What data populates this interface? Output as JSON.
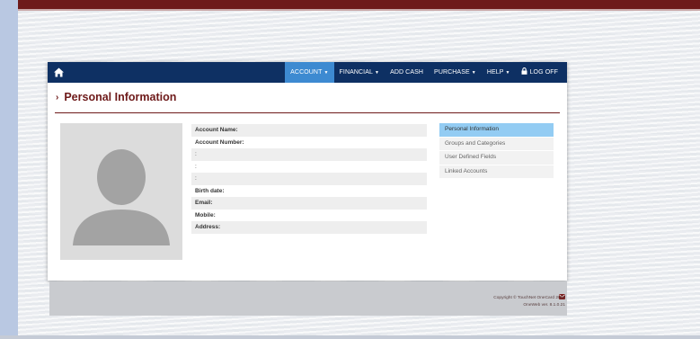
{
  "navbar": {
    "home_icon": "home-icon",
    "items": [
      {
        "label": "ACCOUNT",
        "caret": "▼"
      },
      {
        "label": "FINANCIAL",
        "caret": "▼"
      },
      {
        "label": "ADD CASH"
      },
      {
        "label": "PURCHASE",
        "caret": "▼"
      },
      {
        "label": "HELP",
        "caret": "▼"
      },
      {
        "label": "LOG OFF",
        "icon": "lock-icon"
      }
    ]
  },
  "page": {
    "title_chevron": "›",
    "title": "Personal Information"
  },
  "profile": {
    "fields": [
      {
        "label": "Account Name:"
      },
      {
        "label": "Account Number:"
      },
      {
        "label": ":"
      },
      {
        "label": ":"
      },
      {
        "label": ":"
      },
      {
        "label": "Birth date:"
      },
      {
        "label": "Email:"
      },
      {
        "label": "Mobile:"
      },
      {
        "label": "Address:"
      }
    ]
  },
  "side_menu": {
    "items": [
      {
        "label": "Personal Information",
        "active": true
      },
      {
        "label": "Groups and Categories"
      },
      {
        "label": "User Defined Fields"
      },
      {
        "label": "Linked Accounts"
      }
    ]
  },
  "footer": {
    "copyright": "Copyright © TouchNet OneCard 2021",
    "version": "OneWeb ver. 8.1.0.21",
    "icon": "envelope-icon"
  },
  "colors": {
    "navbar": "#0e3063",
    "active_nav": "#3d8ad1",
    "brand_maroon": "#6e1a1a",
    "active_side": "#93ccf3"
  }
}
